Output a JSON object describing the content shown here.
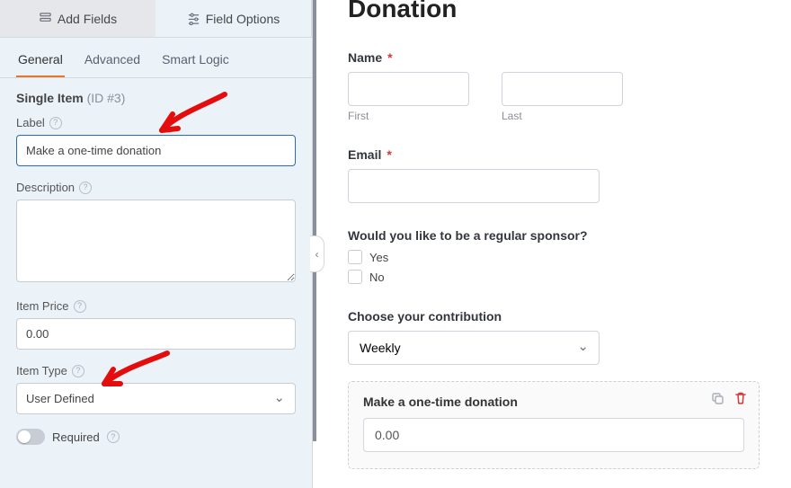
{
  "topTabs": {
    "addFields": "Add Fields",
    "fieldOptions": "Field Options"
  },
  "subTabs": {
    "general": "General",
    "advanced": "Advanced",
    "smartLogic": "Smart Logic"
  },
  "section": {
    "title": "Single Item",
    "idText": "(ID #3)"
  },
  "labels": {
    "label": "Label",
    "description": "Description",
    "itemPrice": "Item Price",
    "itemType": "Item Type",
    "required": "Required"
  },
  "values": {
    "labelInput": "Make a one-time donation",
    "description": "",
    "itemPrice": "0.00",
    "itemType": "User Defined"
  },
  "preview": {
    "title": "Donation",
    "name": {
      "label": "Name",
      "first": "First",
      "last": "Last"
    },
    "email": {
      "label": "Email"
    },
    "sponsor": {
      "label": "Would you like to be a regular sponsor?",
      "yes": "Yes",
      "no": "No"
    },
    "contribution": {
      "label": "Choose your contribution",
      "value": "Weekly"
    },
    "selected": {
      "label": "Make a one-time donation",
      "value": "0.00"
    }
  }
}
